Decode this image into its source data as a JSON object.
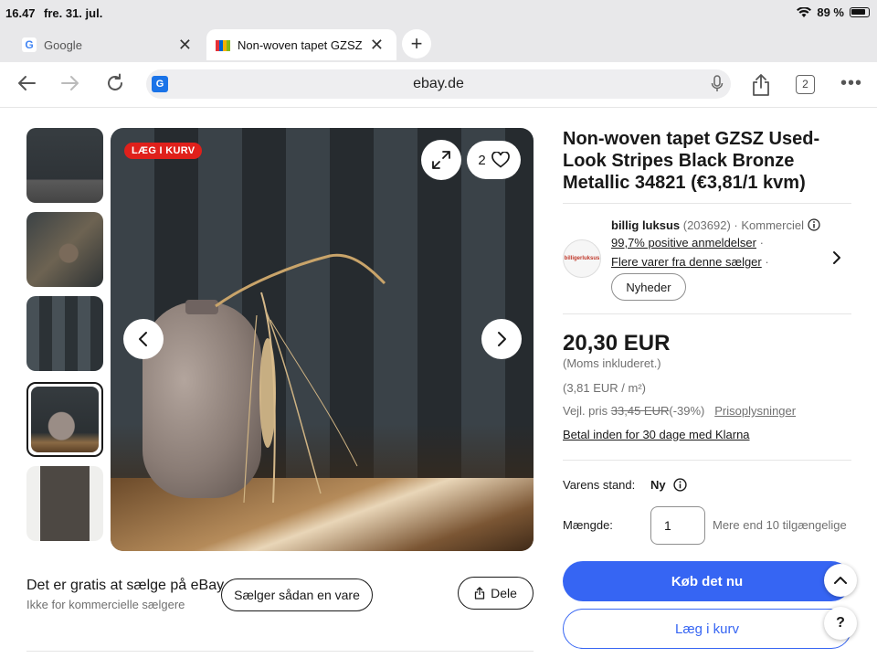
{
  "status_bar": {
    "time": "16.47",
    "date": "fre. 31. jul.",
    "battery": "89 %"
  },
  "tabs": [
    {
      "label": "Google",
      "favicon": "G"
    },
    {
      "label": "Non-woven tapet GZSZ",
      "favicon": "ebay"
    }
  ],
  "toolbar": {
    "url": "ebay.de",
    "tab_count": "2"
  },
  "gallery": {
    "badge": "LÆG I KURV",
    "watch_count": "2"
  },
  "sell": {
    "title": "Det er gratis at sælge på eBay",
    "subtitle": "Ikke for kommercielle sælgere",
    "how_button": "Sælger sådan en vare",
    "share_button": "Dele"
  },
  "product": {
    "title": "Non-woven tapet GZSZ Used-Look Stripes Black Bronze Metallic 34821 (€3,81/1 kvm)",
    "seller": {
      "name": "billig luksus",
      "rating_count": "(203692)",
      "type": "· Kommerciel",
      "positive": "99,7% positive anmeldelser",
      "more_items": "Flere varer fra denne sælger",
      "follow_button": "Nyheder",
      "logo_text": "billigerluksus"
    },
    "price": "20,30 EUR",
    "vat": "(Moms inkluderet.)",
    "unit_price": "(3,81 EUR / m²)",
    "rrp_label": "Vejl. pris",
    "rrp_value": "33,45 EUR",
    "discount": "(-39%)",
    "price_info": "Prisoplysninger",
    "klarna": "Betal inden for 30 dage med Klarna",
    "condition_label": "Varens stand:",
    "condition_value": "Ny",
    "quantity_label": "Mængde:",
    "quantity_value": "1",
    "availability": "Mere end 10 tilgængelige",
    "buy_now": "Køb det nu",
    "add_to_cart": "Læg i kurv"
  },
  "colors": {
    "ebay_blue": "#3665f3",
    "badge_red": "#e0201b"
  }
}
